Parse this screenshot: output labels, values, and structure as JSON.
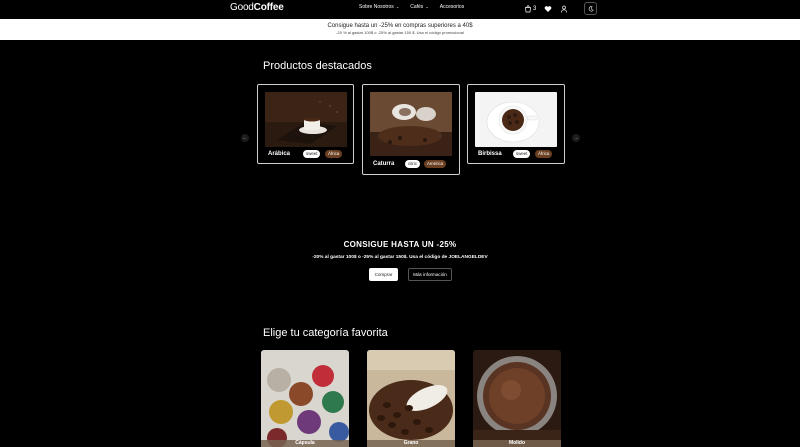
{
  "nav": {
    "logo_part1": "Good",
    "logo_part2": "Coffee",
    "links": [
      "Sobre Nosotros",
      "Cafés",
      "Accesorios"
    ],
    "cart_count": "3",
    "colors": {
      "background": "#000000",
      "text": "#ffffff"
    }
  },
  "promo": {
    "title": "Consigue hasta un -25% en compras superiores a 40$",
    "subtitle": "-20 % al gastar 100$ o -25% al gastar 150 $. Usa el código promocional"
  },
  "featured": {
    "title": "Productos destacados",
    "products": [
      {
        "name": "Arábica",
        "tags": [
          "sweet",
          "África"
        ]
      },
      {
        "name": "Caturra",
        "tags": [
          "citric",
          "América"
        ]
      },
      {
        "name": "Birbissa",
        "tags": [
          "sweet",
          "África"
        ]
      }
    ]
  },
  "discount": {
    "title": "CONSIGUE HASTA UN -25%",
    "subtitle": "-20% al gastar 100$ o -25% al gastar 150$. Usa el código de JOELANGELDEV",
    "buy_label": "Comprar",
    "info_label": "Más información"
  },
  "categories": {
    "title": "Elige tu categoría favorita",
    "items": [
      "Cápsula",
      "Grano",
      "Molido"
    ]
  }
}
